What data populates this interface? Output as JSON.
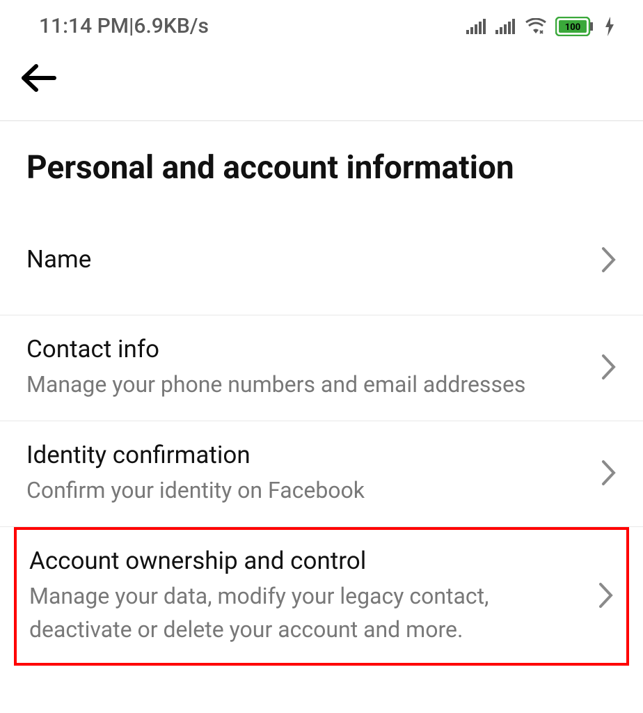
{
  "status_bar": {
    "time": "11:14 PM",
    "separator": " | ",
    "data_rate": "6.9KB/s",
    "battery_level": "100"
  },
  "header": {
    "title": "Personal and account information"
  },
  "settings": {
    "items": [
      {
        "label": "Name",
        "desc": ""
      },
      {
        "label": "Contact info",
        "desc": "Manage your phone numbers and email addresses"
      },
      {
        "label": "Identity confirmation",
        "desc": "Confirm your identity on Facebook"
      },
      {
        "label": "Account ownership and control",
        "desc": "Manage your data, modify your legacy contact, deactivate or delete your account and more."
      }
    ]
  }
}
